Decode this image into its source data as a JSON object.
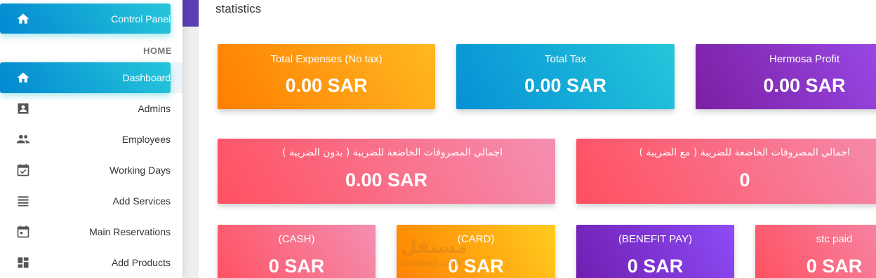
{
  "sidebar": {
    "control_panel": "Control Panel",
    "section": "HOME",
    "items": [
      {
        "label": "Dashboard",
        "icon": "home-icon"
      },
      {
        "label": "Admins",
        "icon": "contact-card-icon"
      },
      {
        "label": "Employees",
        "icon": "people-icon"
      },
      {
        "label": "Working Days",
        "icon": "calendar-check-icon"
      },
      {
        "label": "Add Services",
        "icon": "list-icon"
      },
      {
        "label": "Main Reservations",
        "icon": "calendar-icon"
      },
      {
        "label": "Add Products",
        "icon": "dashboard-grid-icon"
      }
    ]
  },
  "main": {
    "title": "statistics",
    "row1": [
      {
        "label": "Total Expenses (No tax)",
        "value": "0.00 SAR"
      },
      {
        "label": "Total Tax",
        "value": "0.00 SAR"
      },
      {
        "label": "Hermosa Profit",
        "value": "0.00 SAR"
      }
    ],
    "row2": [
      {
        "label": "اجمالي المصروفات الخاضعة للضريبة ( بدون الضريبة )",
        "value": "0.00 SAR"
      },
      {
        "label": "اجمالي المصروفات الخاضعة للضريبة ( مع الضريبة )",
        "value": "0"
      }
    ],
    "row3": [
      {
        "label": "(CASH)",
        "value": "0 SAR"
      },
      {
        "label": "(CARD)",
        "value": "0 SAR"
      },
      {
        "label": "(BENEFIT PAY)",
        "value": "0 SAR"
      },
      {
        "label": "stc paid",
        "value": "0 SAR"
      }
    ]
  },
  "watermark": {
    "arabic": "مستقل",
    "latin": "mostaql.com"
  },
  "colors": {
    "accent_cyan": "#26c6da",
    "accent_orange": "#ff7e00",
    "accent_purple": "#7b1fa2",
    "accent_red": "#ff5061"
  }
}
